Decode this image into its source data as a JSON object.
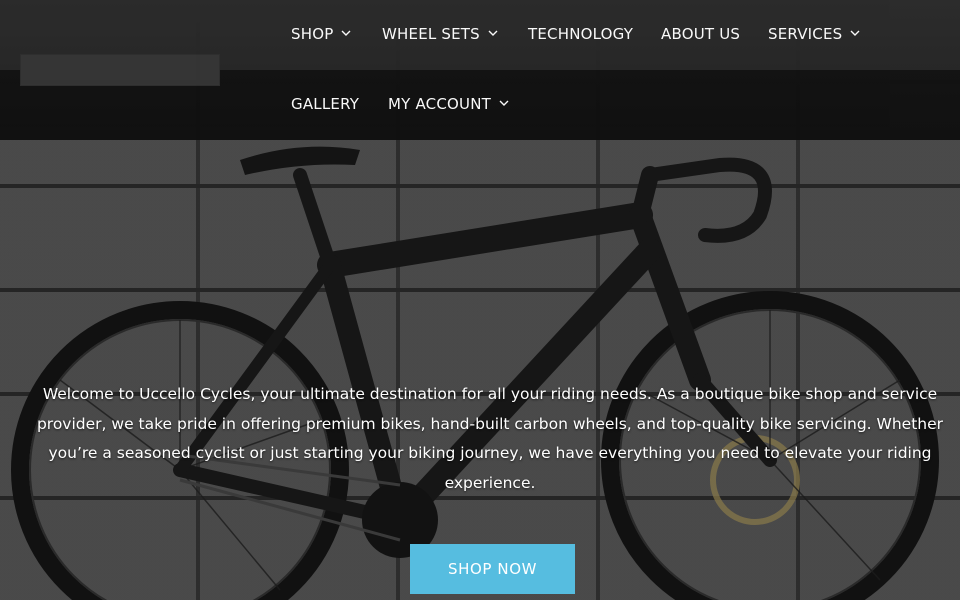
{
  "nav": {
    "items": [
      {
        "label": "SHOP",
        "has_dropdown": true
      },
      {
        "label": "WHEEL SETS",
        "has_dropdown": true
      },
      {
        "label": "TECHNOLOGY",
        "has_dropdown": false
      },
      {
        "label": "ABOUT US",
        "has_dropdown": false
      },
      {
        "label": "SERVICES",
        "has_dropdown": true
      },
      {
        "label": "GALLERY",
        "has_dropdown": false
      },
      {
        "label": "MY ACCOUNT",
        "has_dropdown": true
      }
    ]
  },
  "hero": {
    "intro_text": "Welcome to Uccello Cycles, your ultimate destination for all your riding needs. As a boutique bike shop and service provider, we take pride in offering premium bikes, hand-built carbon wheels, and top-quality bike servicing. Whether you’re a seasoned cyclist or just starting your biking journey, we have everything you need to elevate your riding experience.",
    "cta_label": "SHOP NOW"
  },
  "colors": {
    "cta_background": "#56bde0",
    "header_background": "#262626",
    "nav_text": "#ffffff"
  },
  "icons": {
    "dropdown": "chevron-down-icon"
  }
}
